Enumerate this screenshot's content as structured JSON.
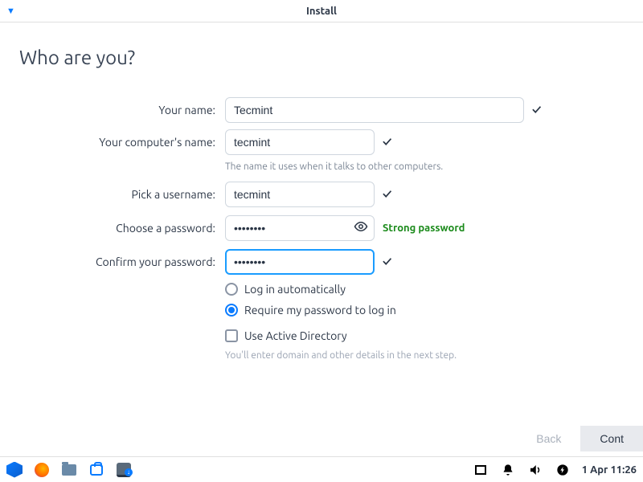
{
  "titlebar": {
    "title": "Install"
  },
  "heading": "Who are you?",
  "labels": {
    "name": "Your name:",
    "computer": "Your computer's name:",
    "computer_help": "The name it uses when it talks to other computers.",
    "username": "Pick a username:",
    "password": "Choose a password:",
    "confirm": "Confirm your password:"
  },
  "values": {
    "name": "Tecmint",
    "computer": "tecmint",
    "username": "tecmint",
    "password": "••••••••",
    "confirm": "••••••••"
  },
  "password_strength": "Strong password",
  "options": {
    "auto_login": "Log in automatically",
    "require_pw": "Require my password to log in",
    "use_ad": "Use Active Directory",
    "ad_help": "You'll enter domain and other details in the next step."
  },
  "nav": {
    "back": "Back",
    "cont": "Cont"
  },
  "taskbar": {
    "clock": "1 Apr 11:26"
  }
}
